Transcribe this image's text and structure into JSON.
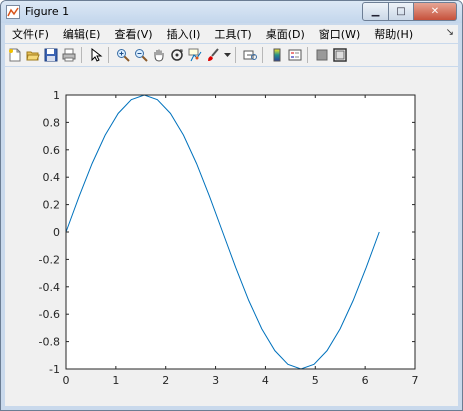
{
  "window": {
    "title": "Figure 1"
  },
  "window_controls": {
    "minimize": "▁",
    "maximize": "□",
    "close": "✕"
  },
  "menubar": {
    "items": [
      "文件(F)",
      "编辑(E)",
      "查看(V)",
      "插入(I)",
      "工具(T)",
      "桌面(D)",
      "窗口(W)",
      "帮助(H)"
    ],
    "dock_glyph": "↘"
  },
  "toolbar": {
    "icons": [
      "new-figure-icon",
      "open-file-icon",
      "save-icon",
      "print-icon",
      "edit-plot-arrow-icon",
      "zoom-in-icon",
      "zoom-out-icon",
      "pan-hand-icon",
      "rotate-3d-icon",
      "data-cursor-icon",
      "brush-icon",
      "brush-dropdown-icon",
      "link-plot-icon",
      "insert-colorbar-icon",
      "insert-legend-icon",
      "hide-plot-tools-icon",
      "show-plot-tools-icon"
    ]
  },
  "chart_data": {
    "type": "line",
    "title": "",
    "xlabel": "",
    "ylabel": "",
    "xlim": [
      0,
      7
    ],
    "ylim": [
      -1,
      1
    ],
    "xticks": [
      "0",
      "1",
      "2",
      "3",
      "4",
      "5",
      "6",
      "7"
    ],
    "yticks": [
      "1",
      "0.8",
      "0.6",
      "0.4",
      "0.2",
      "0",
      "-0.2",
      "-0.4",
      "-0.6",
      "-0.8",
      "-1"
    ],
    "grid": false,
    "series": [
      {
        "color": "#0072bd",
        "x": [
          0,
          0.2618,
          0.5236,
          0.7854,
          1.0472,
          1.309,
          1.5708,
          1.8326,
          2.0944,
          2.3562,
          2.618,
          2.8798,
          3.1416,
          3.4034,
          3.6652,
          3.927,
          4.1888,
          4.4506,
          4.7124,
          4.9742,
          5.236,
          5.4978,
          5.7596,
          6.0214,
          6.2832
        ],
        "y": [
          0,
          0.2588,
          0.5,
          0.7071,
          0.866,
          0.9659,
          1,
          0.9659,
          0.866,
          0.7071,
          0.5,
          0.2588,
          0,
          -0.2588,
          -0.5,
          -0.7071,
          -0.866,
          -0.9659,
          -1,
          -0.9659,
          -0.866,
          -0.7071,
          -0.5,
          -0.2588,
          0
        ]
      }
    ]
  }
}
